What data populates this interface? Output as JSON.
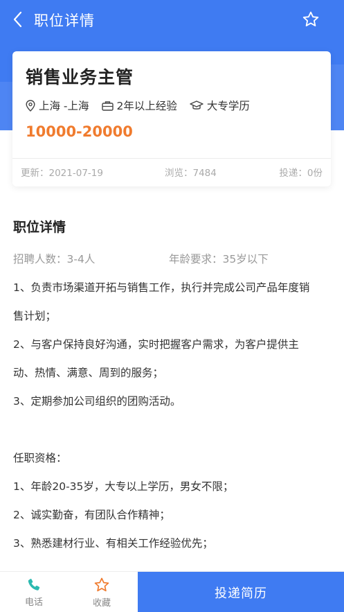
{
  "nav": {
    "title": "职位详情",
    "back_icon": "back-arrow-icon",
    "favorite_icon": "star-outline-icon"
  },
  "colors": {
    "primary": "#3f7bf2",
    "salary": "#f07b2e",
    "muted": "#aaaaaa"
  },
  "job": {
    "title": "销售业务主管",
    "location": "上海 -上海",
    "experience": "2年以上经验",
    "education": "大专学历",
    "salary": "10000-20000",
    "updated": "更新：2021-07-19",
    "views": "浏览：7484",
    "applications": "投递：0份"
  },
  "details": {
    "section_title": "职位详情",
    "headcount": "招聘人数：3-4人",
    "age": "年龄要求：35岁以下",
    "lines": [
      "1、负责市场渠道开拓与销售工作，执行并完成公司产品年度销",
      "售计划；",
      "2、与客户保持良好沟通，实时把握客户需求，为客户提供主",
      "动、热情、满意、周到的服务；",
      "3、定期参加公司组织的团购活动。",
      "",
      "任职资格：",
      "1、年龄20-35岁，大专以上学历，男女不限；",
      "2、诚实勤奋，有团队合作精神；",
      "3、熟悉建材行业、有相关工作经验优先；"
    ]
  },
  "bottom": {
    "phone_label": "电话",
    "favorite_label": "收藏",
    "apply_label": "投递简历"
  }
}
